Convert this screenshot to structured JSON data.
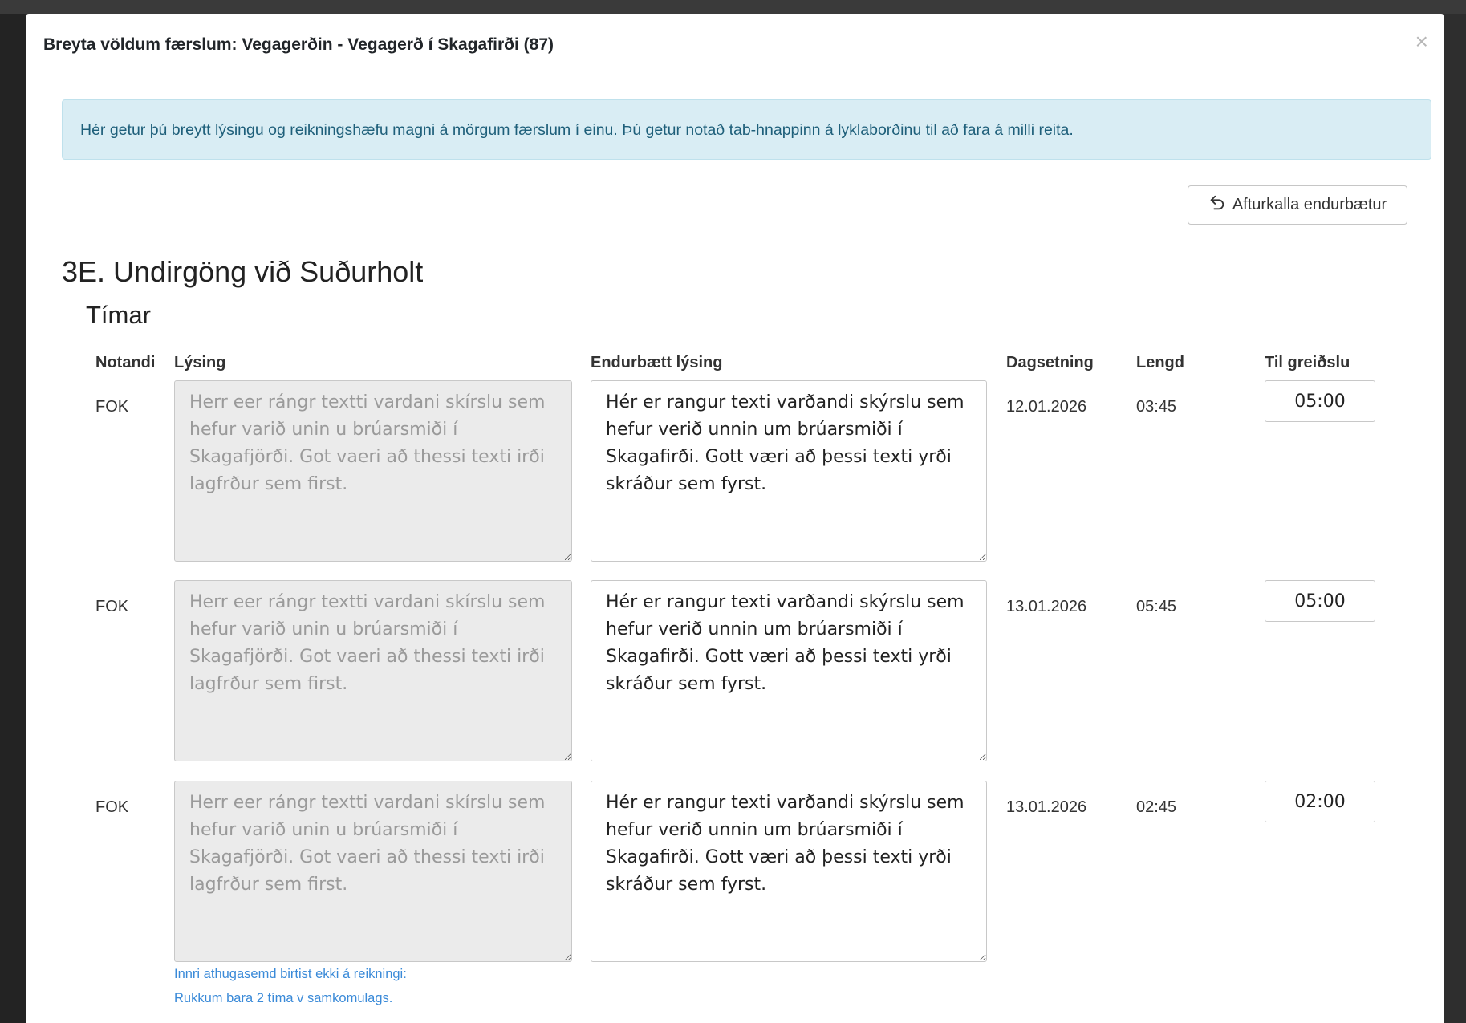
{
  "modal": {
    "title": "Breyta völdum færslum: Vegagerðin - Vegagerð í Skagafirði (87)",
    "close_label": "×",
    "info_text": "Hér getur þú breytt lýsingu og reikningshæfu magni á mörgum færslum í einu. Þú getur notað tab-hnappinn á lyklaborðinu til að fara á milli reita.",
    "undo_button_label": "Afturkalla endurbætur",
    "undo_icon": "undo-arrow-icon"
  },
  "section": {
    "title": "3E. Undirgöng við Suðurholt",
    "subtitle": "Tímar"
  },
  "table": {
    "headers": {
      "user": "Notandi",
      "description": "Lýsing",
      "improved_description": "Endurbætt lýsing",
      "date": "Dagsetning",
      "length": "Lengd",
      "payable": "Til greiðslu"
    },
    "rows": [
      {
        "user": "FOK",
        "description": "Herr eer rángr textti vardani skírslu sem hefur varið unin u brúarsmiði í Skagafjörði. Got vaeri að thessi texti irði lagfrður sem first.",
        "improved_description": "Hér er rangur texti varðandi skýrslu sem hefur verið unnin um brúarsmiði í Skagafirði. Gott væri að þessi texti yrði skráður sem fyrst.",
        "date": "12.01.2026",
        "length": "03:45",
        "payable": "05:00"
      },
      {
        "user": "FOK",
        "description": "Herr eer rángr textti vardani skírslu sem hefur varið unin u brúarsmiði í Skagafjörði. Got vaeri að thessi texti irði lagfrður sem first.",
        "improved_description": "Hér er rangur texti varðandi skýrslu sem hefur verið unnin um brúarsmiði í Skagafirði. Gott væri að þessi texti yrði skráður sem fyrst.",
        "date": "13.01.2026",
        "length": "05:45",
        "payable": "05:00"
      },
      {
        "user": "FOK",
        "description": "Herr eer rángr textti vardani skírslu sem hefur varið unin u brúarsmiði í Skagafjörði. Got vaeri að thessi texti irði lagfrður sem first.",
        "improved_description": "Hér er rangur texti varðandi skýrslu sem hefur verið unnin um brúarsmiði í Skagafirði. Gott væri að þessi texti yrði skráður sem fyrst.",
        "date": "13.01.2026",
        "length": "02:45",
        "payable": "02:00",
        "internal_note_label": "Innri athugasemd birtist ekki á reikningi:",
        "internal_note": "Rukkum bara 2 tíma v samkomulags."
      }
    ]
  }
}
